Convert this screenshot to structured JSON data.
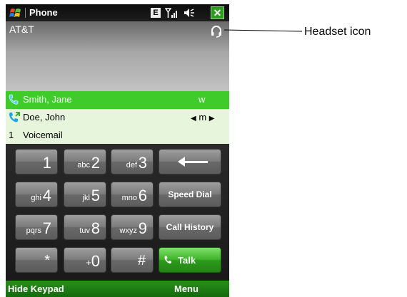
{
  "titlebar": {
    "title": "Phone",
    "indicators": {
      "data_mode": "E",
      "signal": "signal-icon",
      "volume": "speaker-icon",
      "close": "✕"
    }
  },
  "carrier": {
    "name": "AT&T",
    "headset_icon": "headset-icon"
  },
  "contacts": [
    {
      "name": "Smith, Jane",
      "type": "w",
      "selected": true
    },
    {
      "name": "Doe, John",
      "type": "m",
      "selected": false,
      "type_selector": true
    },
    {
      "number": "1",
      "name": "Voicemail"
    }
  ],
  "keypad": {
    "keys": [
      {
        "main": "1",
        "sub": ""
      },
      {
        "main": "2",
        "sub": "abc"
      },
      {
        "main": "3",
        "sub": "def"
      },
      {
        "main": "4",
        "sub": "ghi"
      },
      {
        "main": "5",
        "sub": "jkl"
      },
      {
        "main": "6",
        "sub": "mno"
      },
      {
        "main": "7",
        "sub": "pqrs"
      },
      {
        "main": "8",
        "sub": "tuv"
      },
      {
        "main": "9",
        "sub": "wxyz"
      },
      {
        "main": "*",
        "sub": ""
      },
      {
        "main": "0",
        "sub": "+"
      },
      {
        "main": "#",
        "sub": ""
      }
    ],
    "backspace_icon": "backspace-arrow-icon",
    "speed_dial": "Speed Dial",
    "call_history": "Call History",
    "talk": "Talk"
  },
  "menubar": {
    "left": "Hide Keypad",
    "right": "Menu"
  },
  "annotation": {
    "label": "Headset icon"
  },
  "colors": {
    "selection": "#3fcc2a",
    "menubar": "#1f7f14",
    "talk": "#3fb42a"
  }
}
